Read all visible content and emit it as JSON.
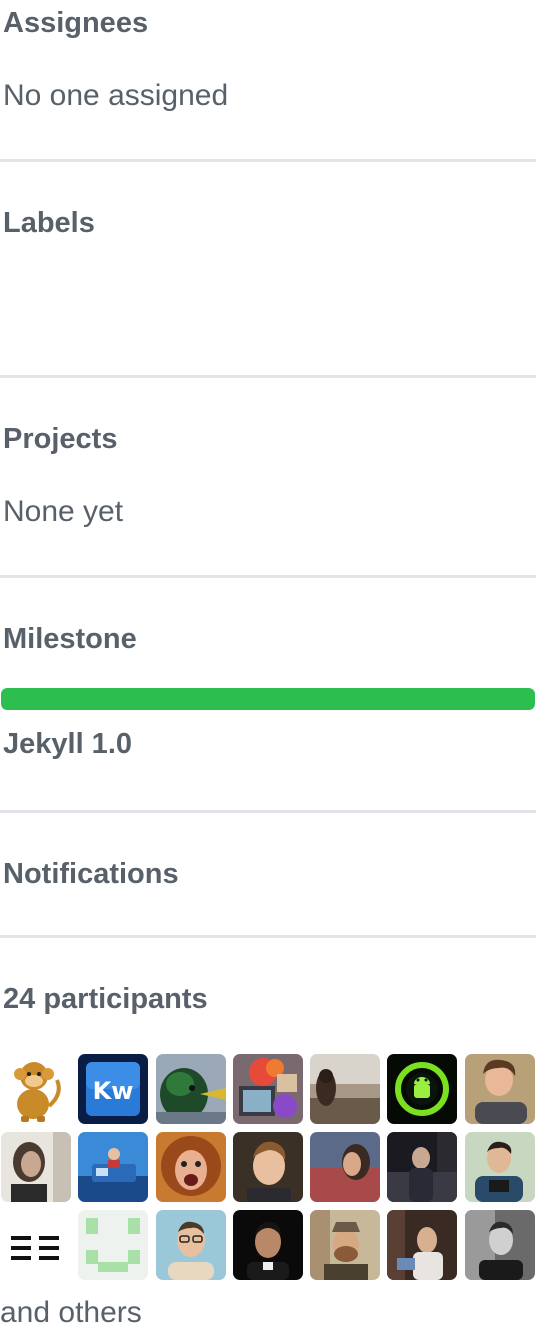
{
  "sidebar": {
    "assignees": {
      "heading": "Assignees",
      "value": "No one assigned"
    },
    "labels": {
      "heading": "Labels"
    },
    "projects": {
      "heading": "Projects",
      "value": "None yet"
    },
    "milestone": {
      "heading": "Milestone",
      "title": "Jekyll 1.0",
      "progress_percent": 100
    },
    "notifications": {
      "heading": "Notifications"
    },
    "participants": {
      "heading": "24 participants",
      "avatar_count": 21,
      "others_text": "and others",
      "kw_text": "Kw"
    }
  },
  "colors": {
    "progress_fill": "#2cbe4e",
    "divider": "#e1e4e8",
    "text": "#586069"
  }
}
